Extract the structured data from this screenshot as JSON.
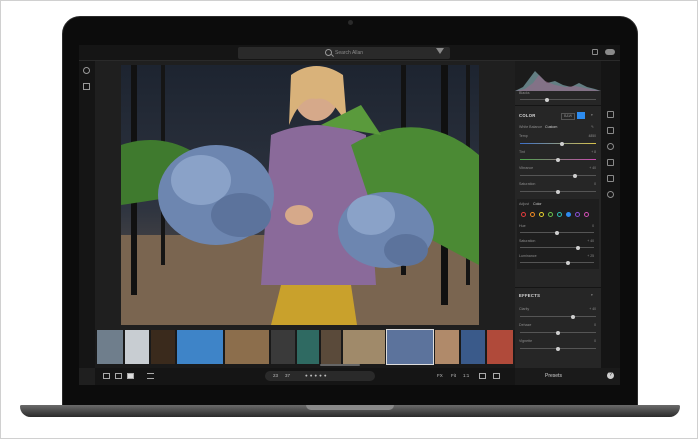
{
  "app": {
    "search_placeholder": "Search Allan",
    "presets_label": "Presets",
    "help_glyph": "?"
  },
  "panel": {
    "blacks_label": "Blacks",
    "color_heading": "COLOR",
    "bw_label": "B&W",
    "white_balance_label": "White Balance",
    "white_balance_value": "Custom",
    "temp_label": "Temp",
    "temp_value": "4850",
    "tint_label": "Tint",
    "tint_value": "+ 8",
    "vibrance_label": "Vibrance",
    "vibrance_value": "+ 40",
    "saturation_label": "Saturation",
    "saturation_value": "0",
    "adjust_label": "Adjust",
    "adjust_value": "Color",
    "hue_label": "Hue",
    "hue_value": "0",
    "sat2_label": "Saturation",
    "sat2_value": "+ 40",
    "luminance_label": "Luminance",
    "luminance_value": "+ 25",
    "effects_heading": "EFFECTS",
    "clarity_label": "Clarity",
    "clarity_value": "+ 40",
    "dehaze_label": "Dehaze",
    "dehaze_value": "0",
    "vignette_label": "Vignette",
    "vignette_value": "0"
  },
  "bottombar": {
    "rating_left": "23",
    "rating_right": "37",
    "fx_label": "FX",
    "fit_label": "Fit",
    "one_to_one_label": "1:1"
  },
  "colors": {
    "screen_bg": "#1f1f1f",
    "panel_bg": "#262626",
    "accent_blue": "#2d8cf0",
    "toolbar_bg": "#151515"
  },
  "sliders": {
    "blacks": 0.35,
    "temp": 0.55,
    "tint": 0.5,
    "vibrance": 0.72,
    "saturation": 0.5,
    "hue": 0.5,
    "sat2": 0.78,
    "luminance": 0.65,
    "clarity": 0.7,
    "dehaze": 0.5,
    "vignette": 0.5
  },
  "mixer_dots": [
    "#e23c3c",
    "#f08a24",
    "#e6d12e",
    "#6cc04a",
    "#2fc0b0",
    "#2d8cf0",
    "#8a4fd6",
    "#d04fb3"
  ],
  "icons": [
    "search-icon",
    "filter-icon",
    "lock-icon",
    "cloud-icon",
    "gear-icon",
    "layers-icon",
    "sliders-icon",
    "crop-icon",
    "healing-icon",
    "brush-icon",
    "gradient-icon",
    "radial-icon",
    "help-icon"
  ]
}
